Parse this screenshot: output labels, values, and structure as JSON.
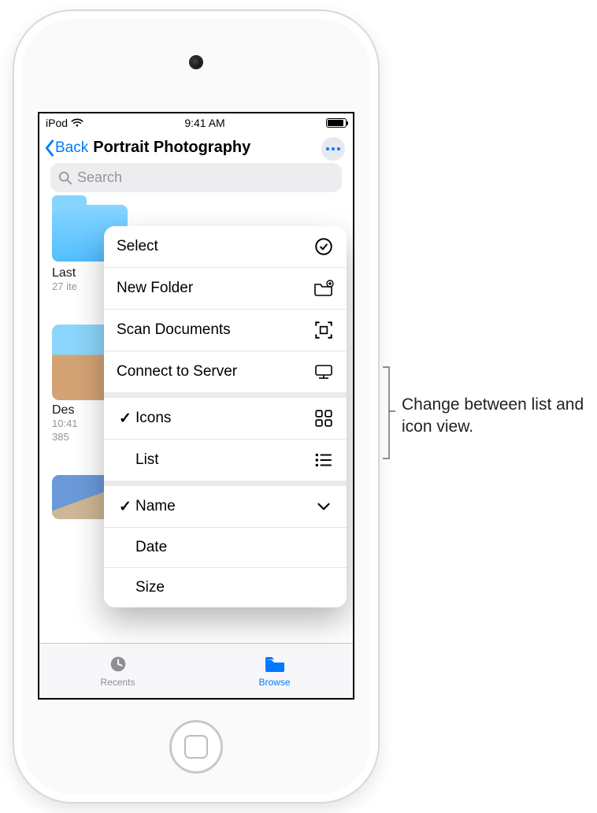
{
  "status_bar": {
    "carrier": "iPod",
    "time": "9:41 AM"
  },
  "nav": {
    "back_label": "Back",
    "title": "Portrait Photography"
  },
  "search": {
    "placeholder": "Search"
  },
  "background_grid": {
    "items": [
      {
        "type": "folder",
        "title": "Last",
        "meta": "27 ite"
      },
      {
        "type": "image",
        "title": "Des",
        "meta1": "10:41",
        "meta2": "385",
        "thumb_class": "thumb-a"
      },
      {
        "type": "image",
        "title": "",
        "meta1": "",
        "meta2": "",
        "thumb_class": "thumb-b"
      },
      {
        "type": "image",
        "title": "",
        "meta1": "",
        "meta2": "",
        "thumb_class": "thumb-c"
      }
    ]
  },
  "menu": {
    "actions": [
      {
        "label": "Select",
        "icon": "select-circle-icon"
      },
      {
        "label": "New Folder",
        "icon": "new-folder-icon"
      },
      {
        "label": "Scan Documents",
        "icon": "scan-icon"
      },
      {
        "label": "Connect to Server",
        "icon": "server-icon"
      }
    ],
    "view": [
      {
        "label": "Icons",
        "checked": true,
        "icon": "grid-icon"
      },
      {
        "label": "List",
        "checked": false,
        "icon": "list-icon"
      }
    ],
    "sort": [
      {
        "label": "Name",
        "checked": true,
        "trailing_icon": "chevron-down-icon"
      },
      {
        "label": "Date",
        "checked": false
      },
      {
        "label": "Size",
        "checked": false
      }
    ]
  },
  "tab_bar": {
    "recents_label": "Recents",
    "browse_label": "Browse",
    "active": "browse"
  },
  "callout": {
    "text": "Change between list and icon view."
  }
}
